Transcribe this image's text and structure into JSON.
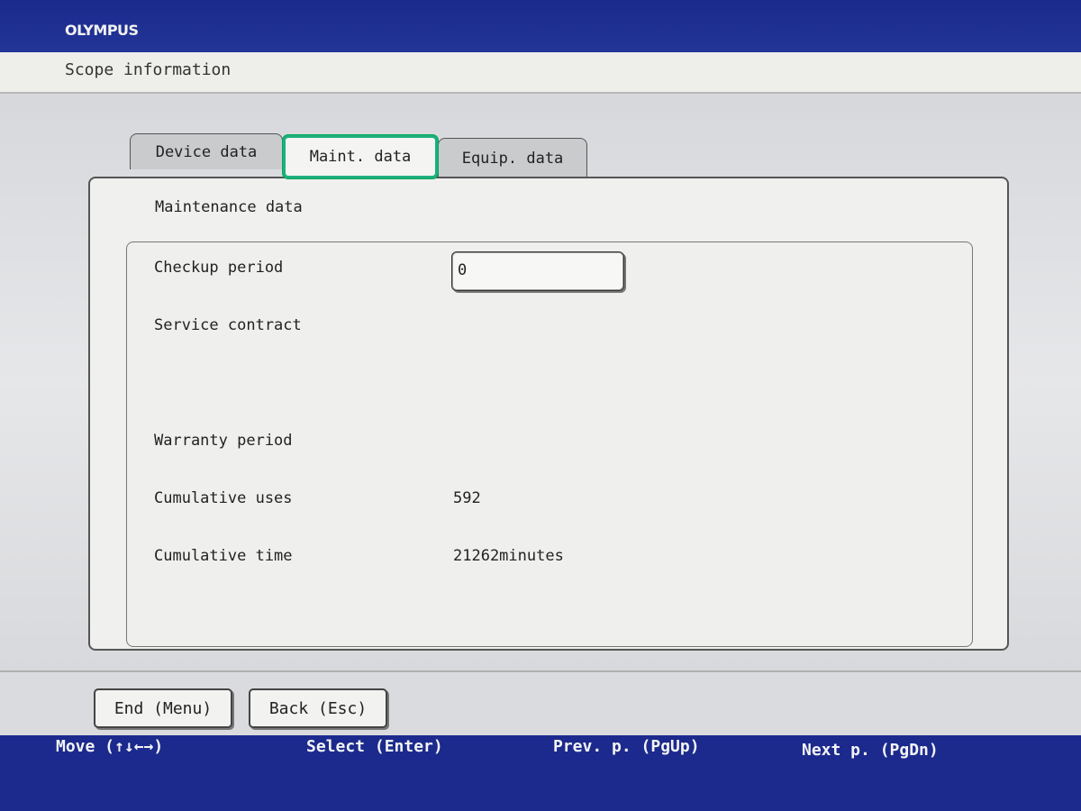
{
  "brand": "OLYMPUS",
  "window_title": "Scope information",
  "tabs": [
    {
      "label": "Device data",
      "active": false
    },
    {
      "label": "Maint. data",
      "active": true
    },
    {
      "label": "Equip. data",
      "active": false
    }
  ],
  "panel": {
    "heading": "Maintenance data",
    "fields": {
      "checkup_period": {
        "label": "Checkup period",
        "value": "0"
      },
      "service_contract": {
        "label": "Service contract",
        "value": ""
      },
      "warranty_period": {
        "label": "Warranty period",
        "value": ""
      },
      "cumulative_uses": {
        "label": "Cumulative uses",
        "value": "592"
      },
      "cumulative_time": {
        "label": "Cumulative time",
        "value": "21262minutes"
      }
    }
  },
  "buttons": {
    "end": "End (Menu)",
    "back": "Back (Esc)"
  },
  "help": {
    "move": "Move (↑↓←→)",
    "select": "Select (Enter)",
    "prev": "Prev. p. (PgUp)",
    "next": "Next p. (PgDn)"
  },
  "colors": {
    "frame_blue": "#1c2a8e",
    "active_tab_border": "#1faf7e"
  }
}
